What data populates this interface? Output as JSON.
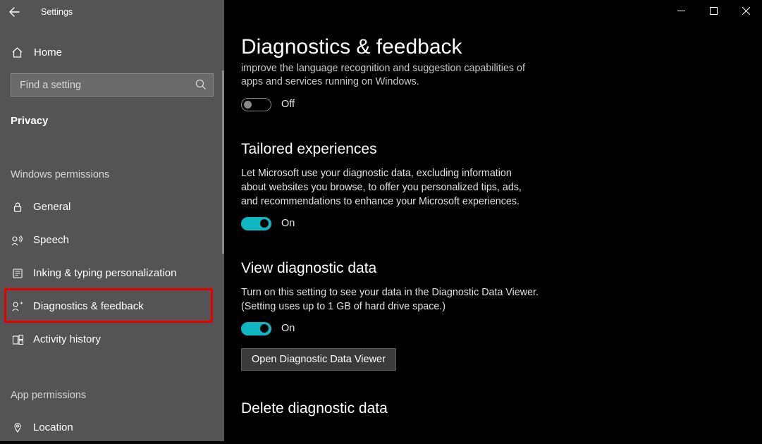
{
  "window": {
    "title": "Settings"
  },
  "sidebar": {
    "home_label": "Home",
    "search_placeholder": "Find a setting",
    "category": "Privacy",
    "section_win_perm": "Windows permissions",
    "section_app_perm": "App permissions",
    "items_win": [
      {
        "label": "General"
      },
      {
        "label": "Speech"
      },
      {
        "label": "Inking & typing personalization"
      },
      {
        "label": "Diagnostics & feedback"
      },
      {
        "label": "Activity history"
      }
    ],
    "items_app": [
      {
        "label": "Location"
      }
    ]
  },
  "main": {
    "page_title": "Diagnostics & feedback",
    "truncated_desc": "improve the language recognition and suggestion capabilities of apps and services running on Windows.",
    "truncated_toggle_state": "Off",
    "tailored": {
      "heading": "Tailored experiences",
      "desc": "Let Microsoft use your diagnostic data, excluding information about websites you browse, to offer you personalized tips, ads, and recommendations to enhance your Microsoft experiences.",
      "state": "On"
    },
    "viewdata": {
      "heading": "View diagnostic data",
      "desc": "Turn on this setting to see your data in the Diagnostic Data Viewer. (Setting uses up to 1 GB of hard drive space.)",
      "state": "On",
      "button": "Open Diagnostic Data Viewer"
    },
    "deletedata": {
      "heading": "Delete diagnostic data"
    }
  }
}
